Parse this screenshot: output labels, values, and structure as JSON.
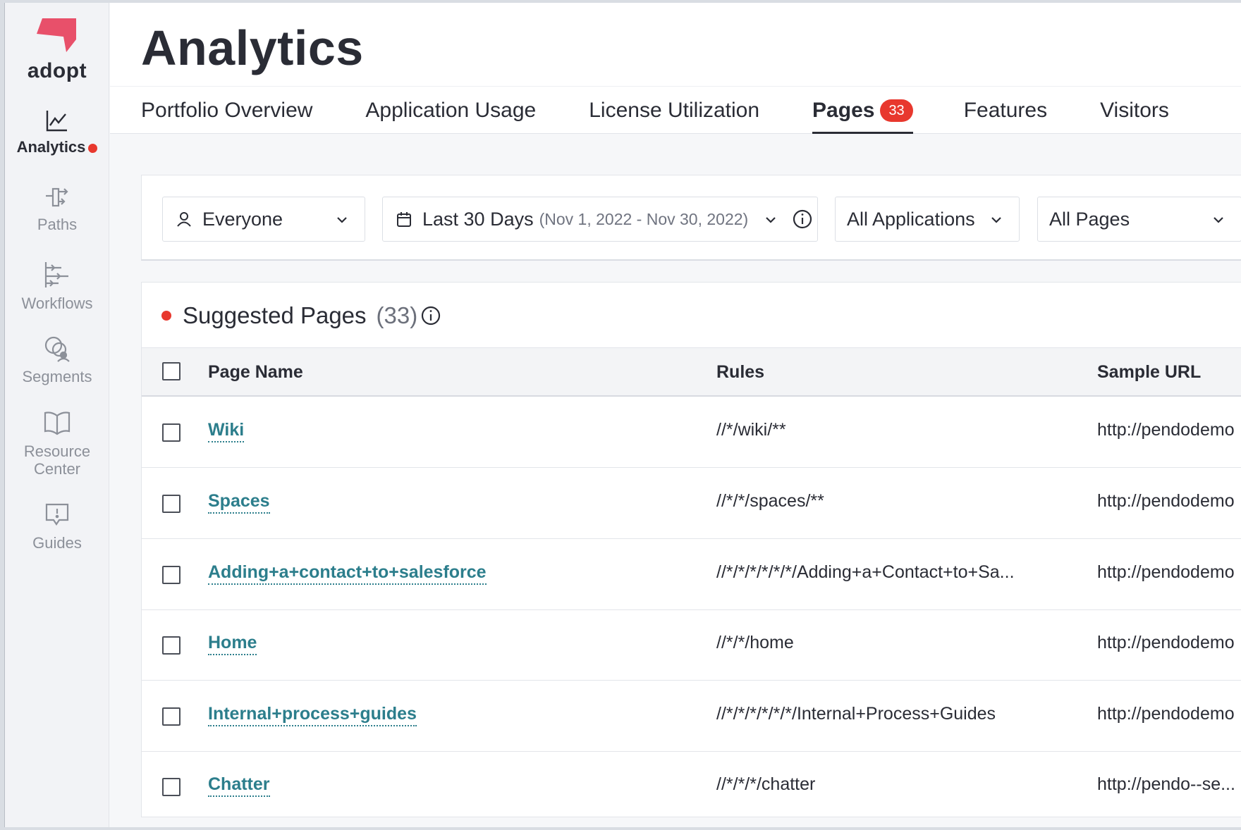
{
  "brand": {
    "name": "adopt",
    "logo_color": "#e8506a"
  },
  "sidebar": {
    "items": [
      {
        "label": "Analytics",
        "icon": "chart-line-icon",
        "active": true,
        "has_dot": true
      },
      {
        "label": "Paths",
        "icon": "paths-icon"
      },
      {
        "label": "Workflows",
        "icon": "workflows-icon"
      },
      {
        "label": "Segments",
        "icon": "segments-icon"
      },
      {
        "label": "Resource Center",
        "icon": "book-icon"
      },
      {
        "label": "Guides",
        "icon": "guides-icon"
      }
    ]
  },
  "header": {
    "title": "Analytics",
    "tabs": [
      {
        "label": "Portfolio Overview"
      },
      {
        "label": "Application Usage"
      },
      {
        "label": "License Utilization"
      },
      {
        "label": "Pages",
        "badge": "33",
        "active": true
      },
      {
        "label": "Features"
      },
      {
        "label": "Visitors"
      }
    ]
  },
  "filters": {
    "segment": {
      "value": "Everyone",
      "icon": "user-icon"
    },
    "date_range": {
      "value": "Last 30 Days",
      "range": "(Nov 1, 2022 - Nov 30, 2022)",
      "icon": "calendar-icon"
    },
    "applications": {
      "value": "All Applications"
    },
    "pages": {
      "value": "All Pages"
    }
  },
  "suggested": {
    "title": "Suggested Pages",
    "count": "(33)",
    "columns": {
      "name": "Page Name",
      "rules": "Rules",
      "url": "Sample URL"
    },
    "rows": [
      {
        "name": "Wiki",
        "rule": "//*/wiki/**",
        "url": "http://pendodemo"
      },
      {
        "name": "Spaces",
        "rule": "//*/*/spaces/**",
        "url": "http://pendodemo"
      },
      {
        "name": "Adding+a+contact+to+salesforce",
        "rule": "//*/*/*/*/*/*/Adding+a+Contact+to+Sa...",
        "url": "http://pendodemo"
      },
      {
        "name": "Home",
        "rule": "//*/*/home",
        "url": "http://pendodemo"
      },
      {
        "name": "Internal+process+guides",
        "rule": "//*/*/*/*/*/*/Internal+Process+Guides",
        "url": "http://pendodemo"
      },
      {
        "name": "Chatter",
        "rule": "//*/*/*/chatter",
        "url": "http://pendo--se..."
      }
    ]
  },
  "colors": {
    "accent_red": "#e8382e",
    "link_teal": "#2c7e8c",
    "text_dark": "#2a2c35"
  }
}
